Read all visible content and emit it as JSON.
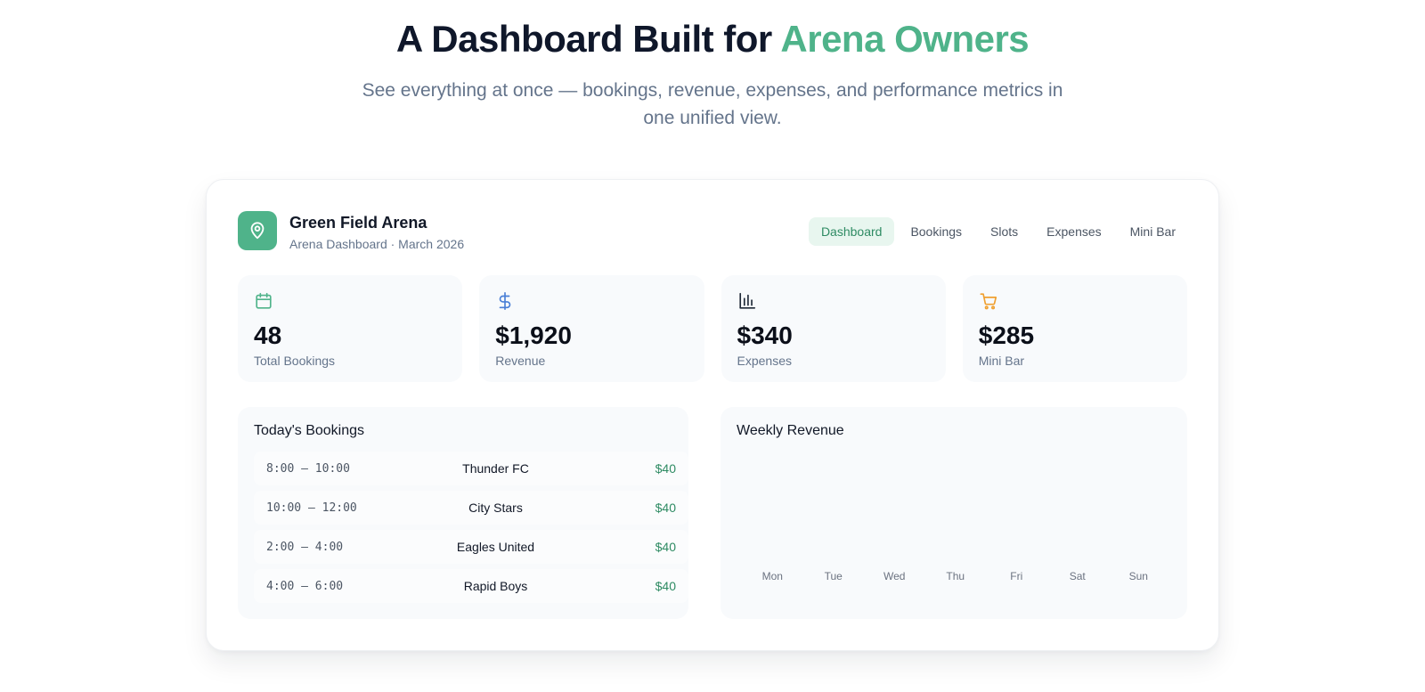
{
  "hero": {
    "title_prefix": "A Dashboard Built for ",
    "title_accent": "Arena Owners",
    "subtitle": "See everything at once — bookings, revenue, expenses, and performance metrics in one unified view."
  },
  "dashboard": {
    "brand": {
      "name": "Green Field Arena",
      "subtitle": "Arena Dashboard · March 2026",
      "icon": "map-pin-icon"
    },
    "nav": {
      "tabs": [
        {
          "label": "Dashboard",
          "active": true
        },
        {
          "label": "Bookings",
          "active": false
        },
        {
          "label": "Slots",
          "active": false
        },
        {
          "label": "Expenses",
          "active": false
        },
        {
          "label": "Mini Bar",
          "active": false
        }
      ]
    },
    "stats": [
      {
        "icon": "calendar-icon",
        "color": "#4fb38a",
        "value": "48",
        "label": "Total Bookings"
      },
      {
        "icon": "dollar-icon",
        "color": "#4a7fd6",
        "value": "$1,920",
        "label": "Revenue"
      },
      {
        "icon": "bar-chart-icon",
        "color": "#1f2937",
        "value": "$340",
        "label": "Expenses"
      },
      {
        "icon": "cart-icon",
        "color": "#f0a030",
        "value": "$285",
        "label": "Mini Bar"
      }
    ],
    "todays_bookings": {
      "title": "Today's Bookings",
      "rows": [
        {
          "time": "8:00 – 10:00",
          "team": "Thunder FC",
          "price": "$40"
        },
        {
          "time": "10:00 – 12:00",
          "team": "City Stars",
          "price": "$40"
        },
        {
          "time": "2:00 – 4:00",
          "team": "Eagles United",
          "price": "$40"
        },
        {
          "time": "4:00 – 6:00",
          "team": "Rapid Boys",
          "price": "$40"
        }
      ]
    },
    "weekly_revenue": {
      "title": "Weekly Revenue",
      "days": [
        "Mon",
        "Tue",
        "Wed",
        "Thu",
        "Fri",
        "Sat",
        "Sun"
      ]
    }
  },
  "colors": {
    "accent": "#4fb38a",
    "accent_dark": "#2e8b63",
    "muted": "#64748b"
  }
}
